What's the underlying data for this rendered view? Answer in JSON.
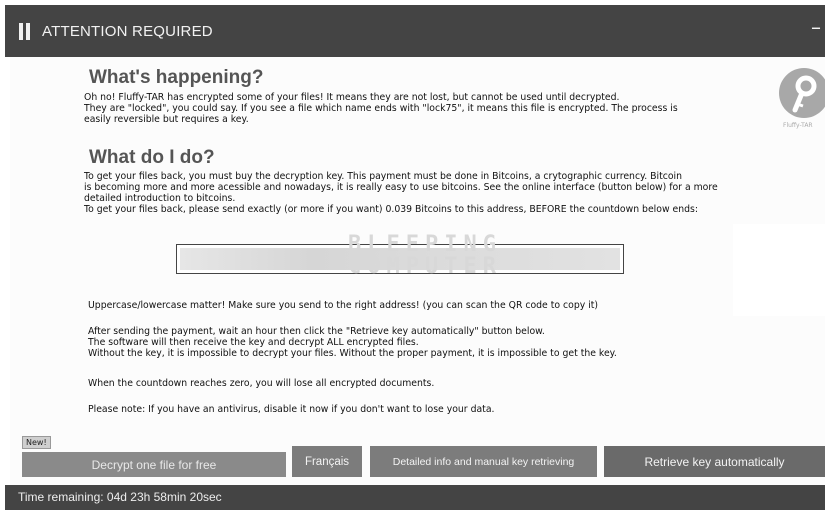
{
  "window": {
    "title": "ATTENTION REQUIRED",
    "minimize_label": "–"
  },
  "logo": {
    "caption": "Fluffy-TAR"
  },
  "section1": {
    "heading": "What's happening?",
    "lines": [
      "Oh no! Fluffy-TAR has encrypted some of your files! It means they are not lost, but cannot be used until decrypted.",
      "They are \"locked\", you could say. If you see a file which name ends with \"lock75\", it means this file is encrypted. The process is",
      "easily reversible but requires a key."
    ]
  },
  "section2": {
    "heading": "What do I do?",
    "lines": [
      "To get your files back, you must buy the decryption key. This payment must be done in Bitcoins, a crytographic currency. Bitcoin",
      "is becoming more and more acessible and nowadays, it is really easy to use bitcoins. See the online interface (button below) for a more",
      "detailed introduction to bitcoins.",
      "To get your files back, please send exactly (or more if you want) 0.039 Bitcoins to this address, BEFORE the countdown below ends:"
    ]
  },
  "address_field": {
    "value": ""
  },
  "watermark": {
    "line1": "BLEEPING",
    "line2": "COMPUTER"
  },
  "notes": {
    "case_note": "Uppercase/lowercase matter! Make sure you send to the right address! (you can scan the QR code to copy it)",
    "after_payment": [
      "After sending the payment, wait an hour then click the \"Retrieve key automatically\" button below.",
      "The software will then receive the key and decrypt ALL encrypted files.",
      "Without the key, it is impossible to decrypt your files. Without the proper payment, it is impossible to get the key."
    ],
    "countdown_note": "When the countdown reaches zero, you will lose all encrypted documents.",
    "antivirus_note": "Please note: If you have an antivirus, disable it now if you don't want to lose your data."
  },
  "buttons": {
    "new_badge": "New!",
    "decrypt_free": "Decrypt one file for free",
    "francais": "Français",
    "detailed_info": "Detailed info and manual key retrieving",
    "retrieve_key": "Retrieve key automatically"
  },
  "status": {
    "time_remaining": "Time remaining: 04d 23h 58min 20sec"
  }
}
